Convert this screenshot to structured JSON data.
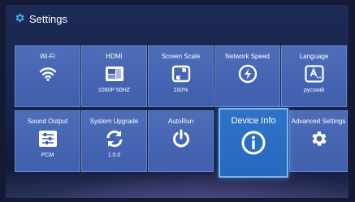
{
  "header": {
    "title": "Settings",
    "icon": "gear-icon"
  },
  "tiles": [
    {
      "label": "Wi-Fi",
      "value": "",
      "icon": "wifi-icon"
    },
    {
      "label": "HDMI",
      "value": "1080P 50HZ",
      "icon": "display-icon"
    },
    {
      "label": "Screen Scale",
      "value": "100%",
      "icon": "scale-icon"
    },
    {
      "label": "Network Speed",
      "value": "",
      "icon": "speed-icon"
    },
    {
      "label": "Language",
      "value": "русский",
      "icon": "language-icon"
    },
    {
      "label": "Sound Output",
      "value": "PCM",
      "icon": "equalizer-icon"
    },
    {
      "label": "System Upgrade",
      "value": "1.0.0",
      "icon": "refresh-icon"
    },
    {
      "label": "AutoRun",
      "value": "",
      "icon": "power-icon"
    },
    {
      "label": "Device Info",
      "value": "",
      "icon": "info-icon",
      "selected": true
    },
    {
      "label": "Advanced Settings",
      "value": "",
      "icon": "gear-icon"
    }
  ],
  "colors": {
    "tile": "#4466b4",
    "selected_tile": "#2a6ec4",
    "background": "#151a34"
  }
}
